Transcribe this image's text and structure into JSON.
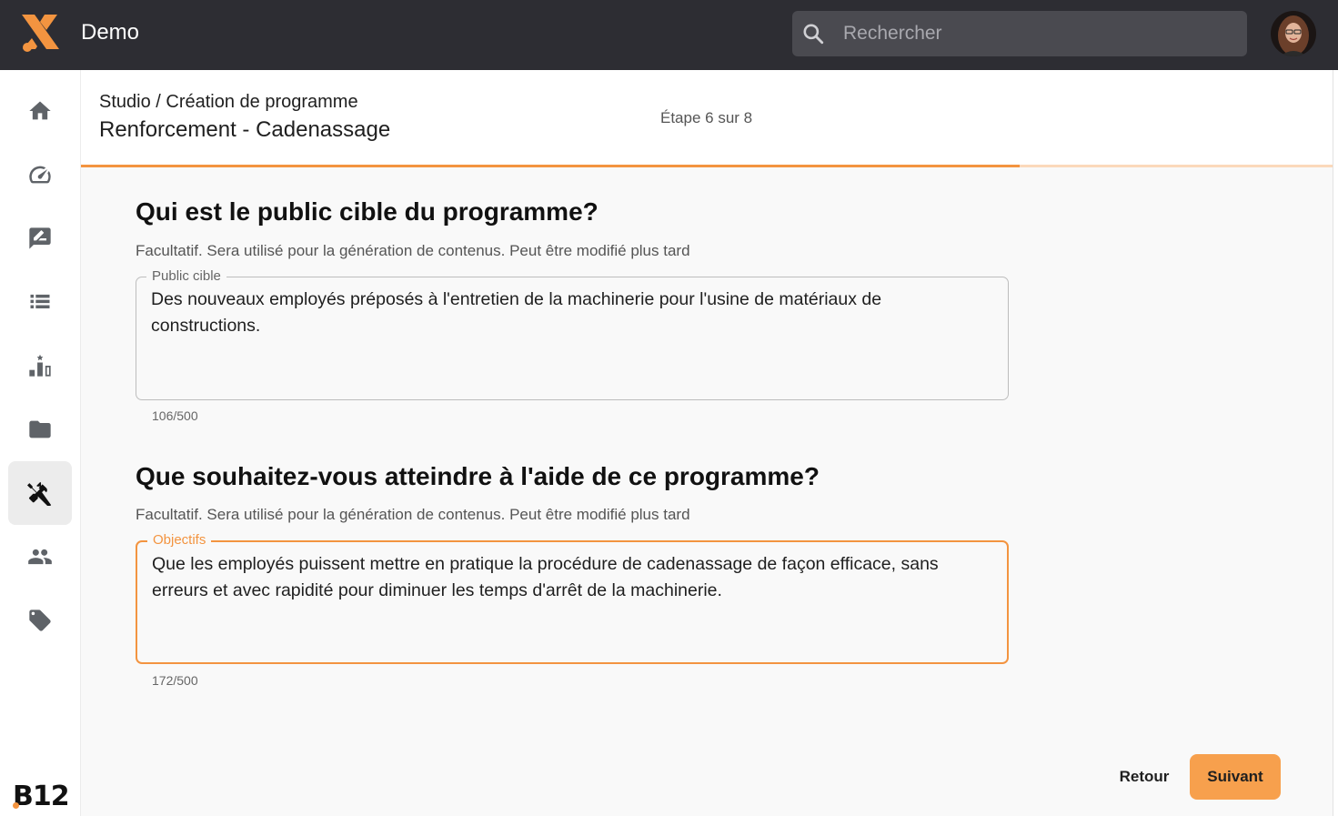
{
  "topbar": {
    "app_title": "Demo",
    "search": {
      "placeholder": "Rechercher",
      "icon": "search-icon"
    },
    "avatar": "user-avatar",
    "logo": "app-logo"
  },
  "sidebar": {
    "items": [
      {
        "icon": "home-icon",
        "active": false
      },
      {
        "icon": "speedometer-icon",
        "active": false
      },
      {
        "icon": "feedback-icon",
        "active": false
      },
      {
        "icon": "list-icon",
        "active": false
      },
      {
        "icon": "leaderboard-icon",
        "active": false
      },
      {
        "icon": "folder-icon",
        "active": false
      },
      {
        "icon": "tools-icon",
        "active": true
      },
      {
        "icon": "people-icon",
        "active": false
      },
      {
        "icon": "tag-icon",
        "active": false
      }
    ],
    "brand": "B12"
  },
  "header": {
    "breadcrumb": "Studio / Création de programme",
    "title": "Renforcement - Cadenassage",
    "step": "Étape 6 sur 8",
    "progress": {
      "current": 6,
      "total": 8
    }
  },
  "questions": [
    {
      "title": "Qui est le public cible du programme?",
      "hint": "Facultatif. Sera utilisé pour la génération de contenus. Peut être modifié plus tard",
      "field_label": "Public cible",
      "value": "Des nouveaux employés préposés à l'entretien de la machinerie pour l'usine de matériaux de constructions.",
      "counter": "106/500"
    },
    {
      "title": "Que souhaitez-vous atteindre à l'aide de ce programme?",
      "hint": "Facultatif. Sera utilisé pour la génération de contenus. Peut être modifié plus tard",
      "field_label": "Objectifs",
      "value": "Que les employés puissent mettre en pratique la procédure de cadenassage de façon efficace, sans erreurs et avec rapidité pour diminuer les temps d'arrêt de la machinerie.",
      "counter": "172/500"
    }
  ],
  "actions": {
    "back_label": "Retour",
    "next_label": "Suivant"
  },
  "colors": {
    "accent": "#f39440",
    "topbar": "#2d2d33",
    "button": "#f7a04d"
  }
}
